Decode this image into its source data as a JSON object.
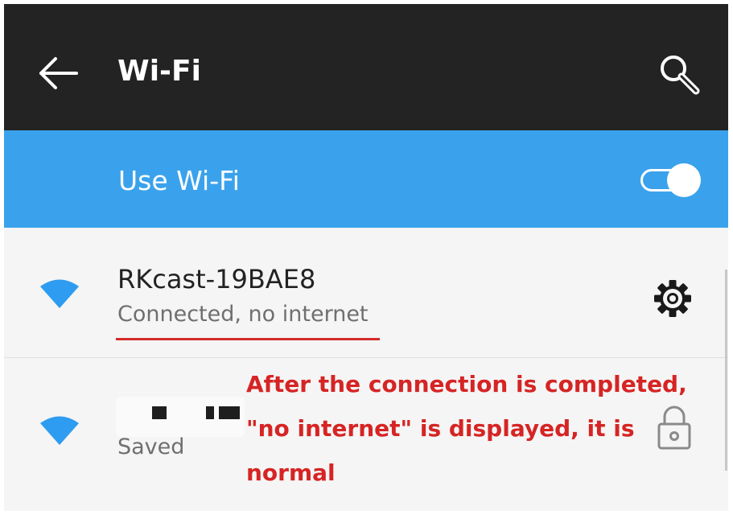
{
  "header": {
    "title": "Wi-Fi"
  },
  "wifi_toggle": {
    "label": "Use Wi-Fi",
    "enabled": true
  },
  "networks": [
    {
      "name": "RKcast-19BAE8",
      "status": "Connected, no internet",
      "action": "settings"
    },
    {
      "name": "",
      "status": "Saved",
      "secured": true
    }
  ],
  "annotation": {
    "text": "After the connection is completed, \"no internet\" is displayed, it is normal",
    "color": "#d62424"
  },
  "colors": {
    "topbar": "#232323",
    "accent": "#3aa2ec",
    "annotation": "#d62424"
  },
  "icons": [
    "back-arrow-icon",
    "search-icon",
    "wifi-icon",
    "gear-icon",
    "lock-icon"
  ]
}
